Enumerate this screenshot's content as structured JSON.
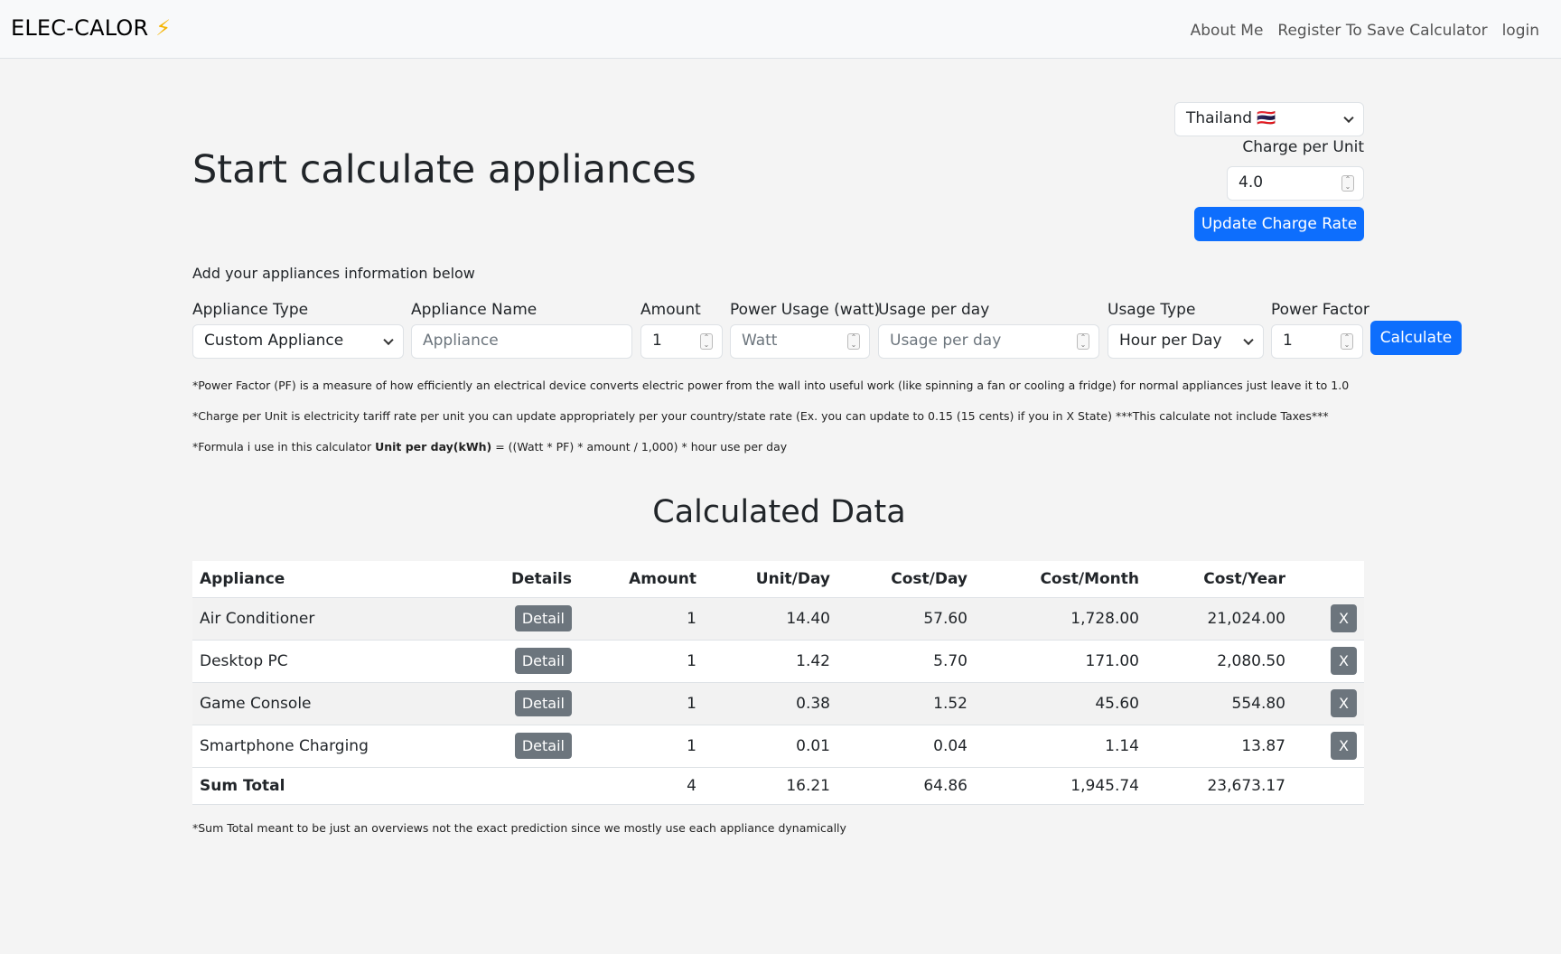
{
  "nav": {
    "brand": "ELEC-CALOR",
    "brand_icon": "⚡",
    "links": [
      "About Me",
      "Register To Save Calculator",
      "login"
    ]
  },
  "header": {
    "title": "Start calculate appliances",
    "country": "Thailand 🇹🇭",
    "charge_label": "Charge per Unit",
    "charge_value": "4.0",
    "update_button": "Update Charge Rate"
  },
  "form": {
    "subtitle": "Add your appliances information below",
    "appliance_type": {
      "label": "Appliance Type",
      "value": "Custom Appliance"
    },
    "appliance_name": {
      "label": "Appliance Name",
      "placeholder": "Appliance"
    },
    "amount": {
      "label": "Amount",
      "value": "1"
    },
    "power_usage": {
      "label": "Power Usage (watt)",
      "placeholder": "Watt"
    },
    "usage_per_day": {
      "label": "Usage per day",
      "placeholder": "Usage per day"
    },
    "usage_type": {
      "label": "Usage Type",
      "value": "Hour per Day"
    },
    "power_factor": {
      "label": "Power Factor",
      "value": "1"
    },
    "calculate_button": "Calculate"
  },
  "notes": {
    "pf": "*Power Factor (PF) is a measure of how efficiently an electrical device converts electric power from the wall into useful work (like spinning a fan or cooling a fridge) for normal appliances just leave it to 1.0",
    "charge": "*Charge per Unit is electricity tariff rate per unit you can update appropriately per your country/state rate (Ex. you can update to 0.15 (15 cents) if you in X State) ***This calculate not include Taxes***",
    "formula_prefix": "*Formula i use in this calculator ",
    "formula_bold": "Unit per day(kWh)",
    "formula_rest": " = ((Watt * PF) * amount / 1,000) * hour use per day",
    "sum_note": "*Sum Total meant to be just an overviews not the exact prediction since we mostly use each appliance dynamically"
  },
  "table": {
    "title": "Calculated Data",
    "headers": [
      "Appliance",
      "Details",
      "Amount",
      "Unit/Day",
      "Cost/Day",
      "Cost/Month",
      "Cost/Year"
    ],
    "detail_label": "Detail",
    "delete_label": "X",
    "rows": [
      [
        "Air Conditioner",
        "1",
        "14.40",
        "57.60",
        "1,728.00",
        "21,024.00"
      ],
      [
        "Desktop PC",
        "1",
        "1.42",
        "5.70",
        "171.00",
        "2,080.50"
      ],
      [
        "Game Console",
        "1",
        "0.38",
        "1.52",
        "45.60",
        "554.80"
      ],
      [
        "Smartphone Charging",
        "1",
        "0.01",
        "0.04",
        "1.14",
        "13.87"
      ]
    ],
    "total": [
      "Sum Total",
      "4",
      "16.21",
      "64.86",
      "1,945.74",
      "23,673.17"
    ]
  }
}
